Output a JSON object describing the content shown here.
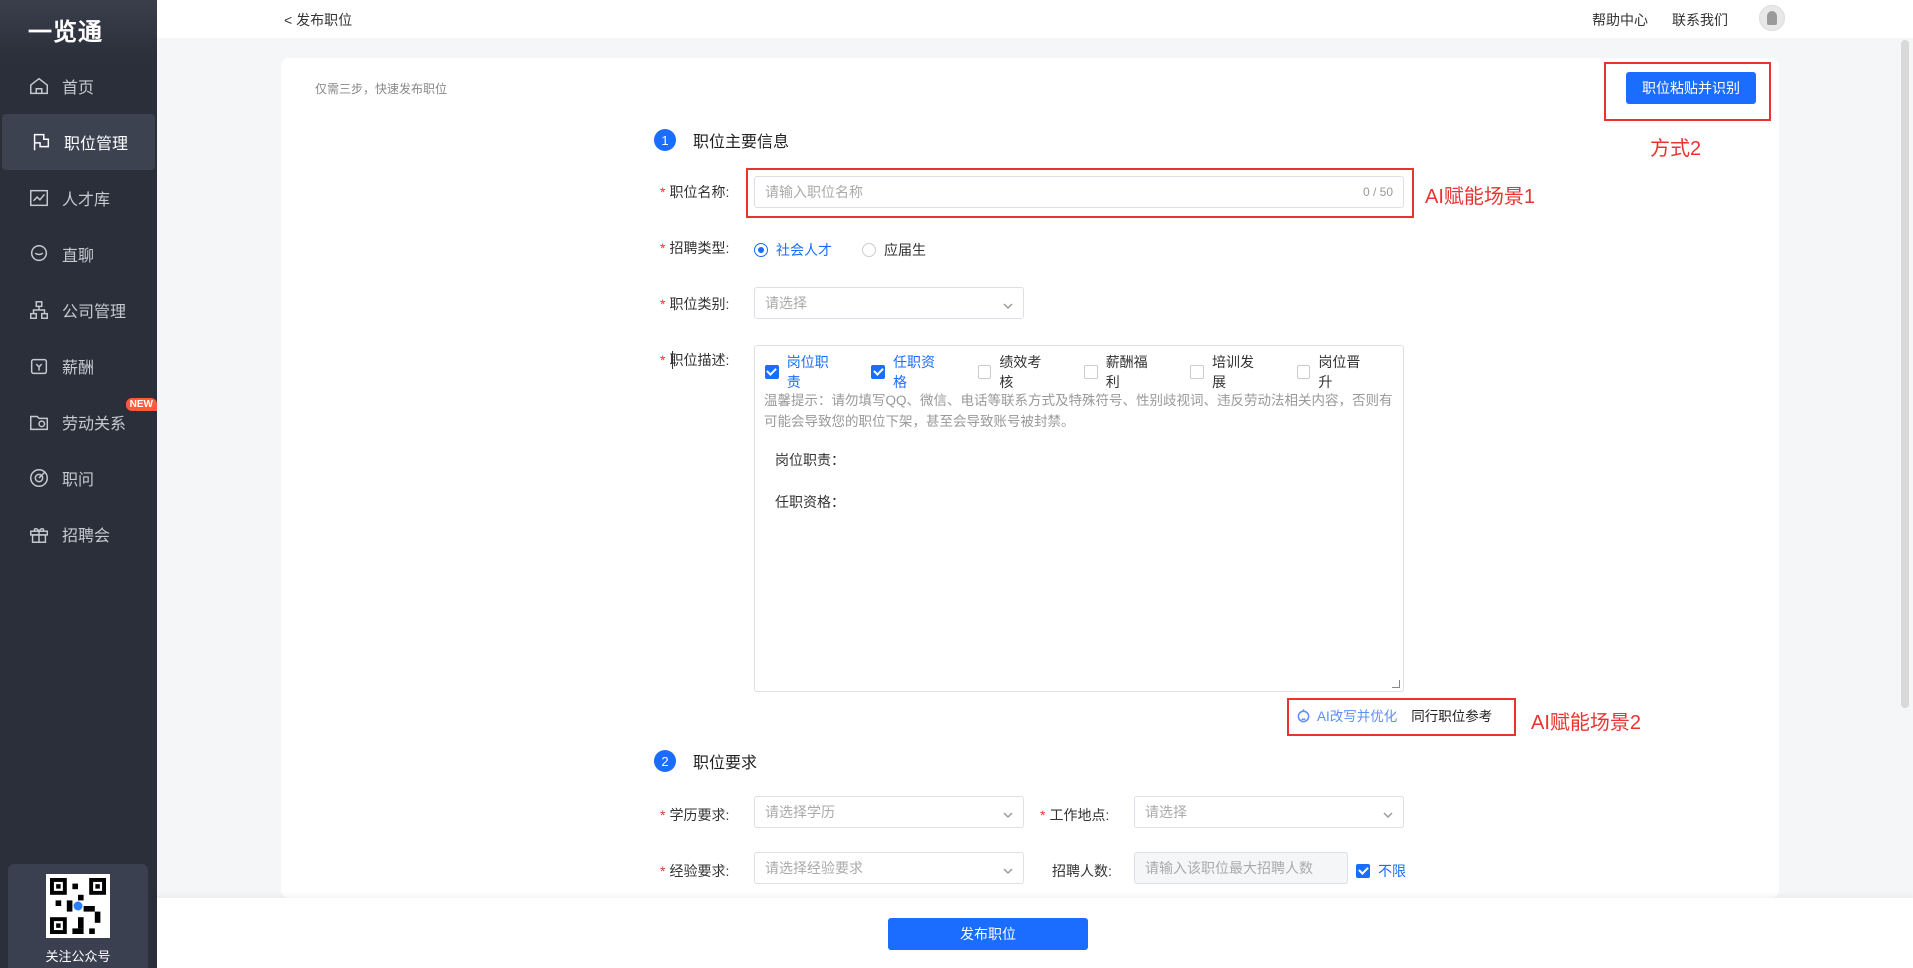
{
  "sidebar": {
    "logo": "一览通",
    "items": [
      {
        "label": "首页",
        "icon": "home-icon"
      },
      {
        "label": "职位管理",
        "icon": "flag-icon",
        "active": true
      },
      {
        "label": "人才库",
        "icon": "chart-icon"
      },
      {
        "label": "直聊",
        "icon": "chat-icon"
      },
      {
        "label": "公司管理",
        "icon": "org-icon"
      },
      {
        "label": "薪酬",
        "icon": "wallet-icon"
      },
      {
        "label": "劳动关系",
        "icon": "folder-icon",
        "badge": "NEW"
      },
      {
        "label": "职问",
        "icon": "target-icon"
      },
      {
        "label": "招聘会",
        "icon": "gift-icon"
      }
    ],
    "qr_label": "关注公众号"
  },
  "topbar": {
    "back": "< 发布职位",
    "help": "帮助中心",
    "contact": "联系我们"
  },
  "page": {
    "hint": "仅需三步，快速发布职位",
    "paste_button": "职位粘贴并识别",
    "annotation_paste": "方式2",
    "annotation_name": "AI赋能场景1",
    "annotation_ai": "AI赋能场景2"
  },
  "step1": {
    "num": "1",
    "title": "职位主要信息",
    "name_label": "职位名称:",
    "name_placeholder": "请输入职位名称",
    "name_counter": "0 / 50",
    "type_label": "招聘类型:",
    "type_options": [
      "社会人才",
      "应届生"
    ],
    "category_label": "职位类别:",
    "category_placeholder": "请选择",
    "desc_label": "职位描述:",
    "desc_tabs": [
      {
        "label": "岗位职责",
        "checked": true
      },
      {
        "label": "任职资格",
        "checked": true
      },
      {
        "label": "绩效考核",
        "checked": false
      },
      {
        "label": "薪酬福利",
        "checked": false
      },
      {
        "label": "培训发展",
        "checked": false
      },
      {
        "label": "岗位晋升",
        "checked": false
      }
    ],
    "warm_tip": "温馨提示：请勿填写QQ、微信、电话等联系方式及特殊符号、性别歧视词、违反劳动法相关内容，否则有可能会导致您的职位下架，甚至会导致账号被封禁。",
    "desc_line1": "岗位职责：",
    "desc_line2": "任职资格：",
    "ai_rewrite": "AI改写并优化",
    "peer_ref": "同行职位参考"
  },
  "step2": {
    "num": "2",
    "title": "职位要求",
    "edu_label": "学历要求:",
    "edu_placeholder": "请选择学历",
    "location_label": "工作地点:",
    "location_placeholder": "请选择",
    "exp_label": "经验要求:",
    "exp_placeholder": "请选择经验要求",
    "headcount_label": "招聘人数:",
    "headcount_placeholder": "请输入该职位最大招聘人数",
    "unlimited": "不限"
  },
  "footer": {
    "publish": "发布职位"
  },
  "colors": {
    "primary": "#1a6dff",
    "annotation": "#e8332f",
    "sidebar": "#2b2f3a"
  }
}
